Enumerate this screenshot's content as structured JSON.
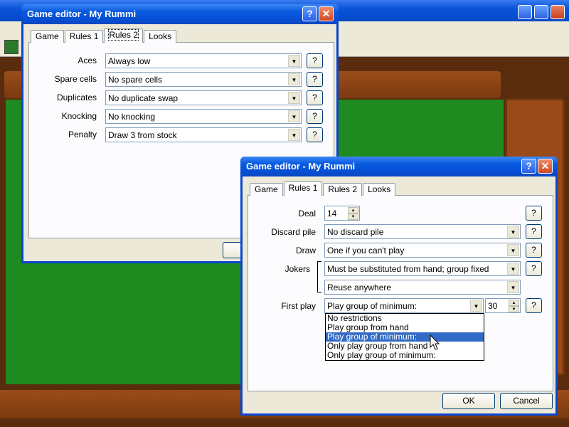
{
  "back_dialog": {
    "title": "Game editor - My Rummi",
    "tabs": [
      {
        "label": "Game"
      },
      {
        "label": "Rules 1"
      },
      {
        "label": "Rules 2"
      },
      {
        "label": "Looks"
      }
    ],
    "rows": [
      {
        "label": "Aces",
        "value": "Always low"
      },
      {
        "label": "Spare cells",
        "value": "No spare cells"
      },
      {
        "label": "Duplicates",
        "value": "No duplicate swap"
      },
      {
        "label": "Knocking",
        "value": "No knocking"
      },
      {
        "label": "Penalty",
        "value": "Draw 3 from stock"
      }
    ],
    "help_label": "?",
    "help_title_label": "?",
    "close_label": "✕"
  },
  "front_dialog": {
    "title": "Game editor - My Rummi",
    "tabs": [
      {
        "label": "Game"
      },
      {
        "label": "Rules 1"
      },
      {
        "label": "Rules 2"
      },
      {
        "label": "Looks"
      }
    ],
    "deal": {
      "label": "Deal",
      "value": "14"
    },
    "discard": {
      "label": "Discard pile",
      "value": "No discard pile"
    },
    "draw": {
      "label": "Draw",
      "value": "One if you can't play"
    },
    "jokers": {
      "label": "Jokers",
      "value1": "Must be substituted from hand; group fixed",
      "value2": "Reuse anywhere"
    },
    "first_play": {
      "label": "First play",
      "value": "Play group of minimum:",
      "minimum": "30",
      "options": [
        "No restrictions",
        "Play group from hand",
        "Play group of minimum:",
        "Only play group from hand",
        "Only play group of minimum:"
      ],
      "selected_index": 2
    },
    "help_label": "?",
    "help_title_label": "?",
    "close_label": "✕",
    "ok_label": "OK",
    "cancel_label": "Cancel"
  },
  "colors": {
    "titlebar": "#0a5ce0",
    "selection": "#316ac5",
    "felt": "#1f8a1f",
    "wood": "#9a4d1a"
  }
}
